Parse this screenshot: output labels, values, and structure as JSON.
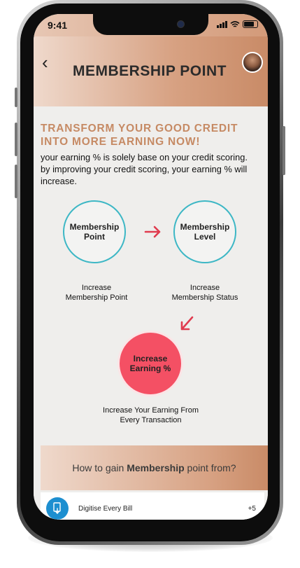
{
  "status": {
    "time": "9:41"
  },
  "header": {
    "title": "MEMBERSHIP POINT",
    "back_icon": "chevron-left-icon",
    "avatar_icon": "user-avatar"
  },
  "intro": {
    "headline_line1": "TRANSFORM YOUR GOOD CREDIT",
    "headline_line2": "INTO MORE EARNING NOW!",
    "description": "your earning % is solely base on your credit scoring. by improving your credit scoring, your earning % will increase."
  },
  "flow": {
    "point": {
      "line1": "Membership",
      "line2": "Point",
      "caption1": "Increase",
      "caption2": "Membership Point"
    },
    "level": {
      "line1": "Membership",
      "line2": "Level",
      "caption1": "Increase",
      "caption2": "Membership Status"
    },
    "earning": {
      "line1": "Increase",
      "line2": "Earning %",
      "caption1": "Increase Your Earning From",
      "caption2": "Every Transaction"
    }
  },
  "gain": {
    "prefix": "How to gain ",
    "bold": "Membership",
    "suffix": " point from?"
  },
  "items": [
    {
      "label": "Digitise Every Bill",
      "value": "+5",
      "icon": "bill-touch-icon"
    }
  ],
  "colors": {
    "accent": "#c68a64",
    "ring": "#3db7c5",
    "earning": "#f45064",
    "arrow": "#e03b4e",
    "icon_bg": "#1d8fd0"
  }
}
